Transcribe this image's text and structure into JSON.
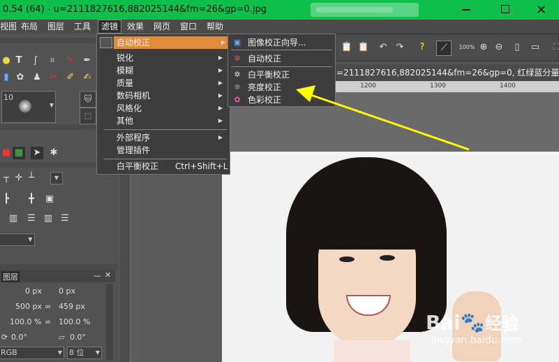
{
  "window": {
    "title": "0.54 (64) - u=2111827616,882025144&fm=26&gp=0.jpg"
  },
  "menubar": {
    "items": [
      {
        "label": "视图"
      },
      {
        "label": "布局"
      },
      {
        "label": "图层"
      },
      {
        "label": "工具"
      },
      {
        "label": "滤镜"
      },
      {
        "label": "效果"
      },
      {
        "label": "网页"
      },
      {
        "label": "窗口"
      },
      {
        "label": "帮助"
      }
    ]
  },
  "filter_menu": {
    "items": [
      {
        "label": "自动校正"
      },
      {
        "label": "锐化"
      },
      {
        "label": "模糊"
      },
      {
        "label": "质量"
      },
      {
        "label": "数码相机"
      },
      {
        "label": "风格化"
      },
      {
        "label": "其他"
      },
      {
        "label": "外部程序"
      },
      {
        "label": "管理插件"
      },
      {
        "label": "白平衡校正",
        "shortcut": "Ctrl+Shift+L"
      }
    ]
  },
  "auto_correct_submenu": {
    "items": [
      {
        "label": "图像校正向导..."
      },
      {
        "label": "自动校正"
      },
      {
        "label": "白平衡校正"
      },
      {
        "label": "亮度校正"
      },
      {
        "label": "色彩校正"
      }
    ]
  },
  "toolbar": {
    "zoom_label": "100%"
  },
  "address_bar": {
    "text": "=2111827616,882025144&fm=26&gp=0, 红绿蓝分量 ( R"
  },
  "ruler": {
    "ticks": [
      "1200",
      "1300",
      "1400"
    ]
  },
  "left_panel": {
    "brush_size": "10",
    "layers_tab": "图层",
    "pos_x": "0 px",
    "pos_y": "0 px",
    "width": "500 px",
    "height": "459 px",
    "scale_x": "100.0 %",
    "scale_y": "100.0 %",
    "angle1": "0.0°",
    "angle2": "0.0°",
    "color_mode": "RGB",
    "bit_depth": "8 位"
  },
  "watermark": {
    "brand": "Bai",
    "brand2": "经验",
    "url": "jingyan.baidu.com"
  },
  "colors": {
    "titlebar": "#0fbf4c",
    "menu_highlight": "#e08a3c",
    "arrow": "#ffff00"
  }
}
